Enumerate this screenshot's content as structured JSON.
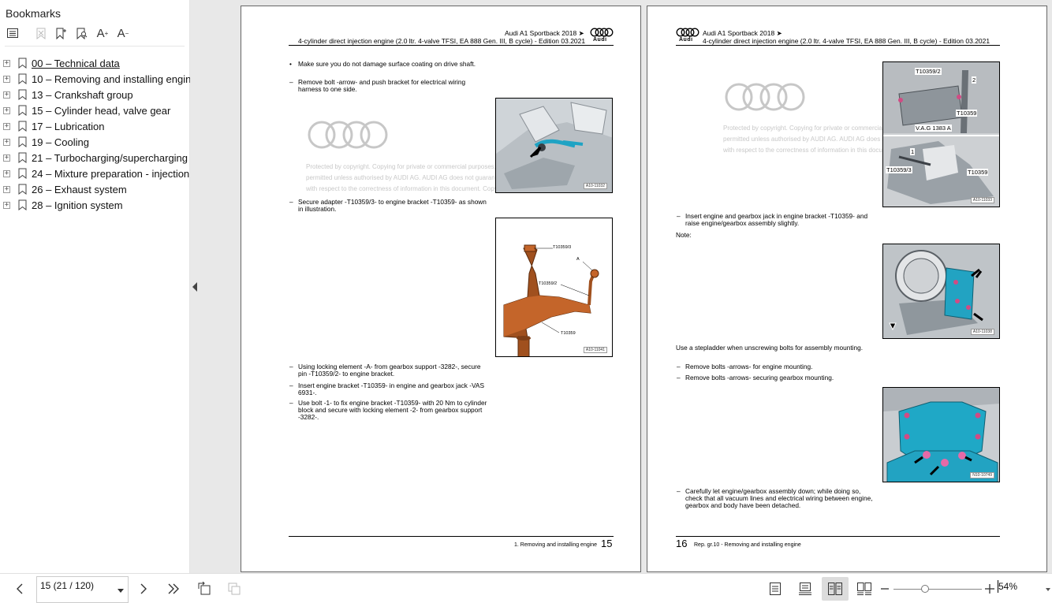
{
  "sidebar": {
    "title": "Bookmarks",
    "toolbar_icons": [
      "bookmark-options-icon",
      "delete-bookmark-icon",
      "add-bookmark-icon",
      "find-bookmark-icon",
      "increase-text-size-icon",
      "decrease-text-size-icon"
    ],
    "items": [
      {
        "label": "00 – Technical data",
        "active": true
      },
      {
        "label": "10 – Removing and installing engine"
      },
      {
        "label": "13 – Crankshaft group"
      },
      {
        "label": "15 – Cylinder head, valve gear"
      },
      {
        "label": "17 – Lubrication"
      },
      {
        "label": "19 – Cooling"
      },
      {
        "label": "21 – Turbocharging/supercharging"
      },
      {
        "label": "24 – Mixture preparation - injection"
      },
      {
        "label": "26 – Exhaust system"
      },
      {
        "label": "28 – Ignition system"
      }
    ]
  },
  "document": {
    "header_model": "Audi A1 Sportback 2018 ➤",
    "header_engine": "4-cylinder direct injection engine (2.0 ltr. 4-valve TFSI, EA 888 Gen. III, B cycle) - Edition 03.2021",
    "audi_word": "Audi",
    "watermark": {
      "line1": "Protected by copyright. Copying for private or commercial purposes, in part or in whole, is not",
      "line2": "permitted unless authorised by AUDI AG. AUDI AG does not guarantee or accept any liability",
      "line3": "with respect to the correctness of information in this document. Copyright by AUDI AG."
    },
    "left_page": {
      "steps": [
        "Make sure you do not damage surface coating on drive shaft.",
        "Remove bolt -arrow- and push bracket for electrical wiring harness to one side.",
        "Secure adapter -T10359/3- to engine bracket -T10359- as shown in illustration.",
        "Using locking element -A- from gearbox support -3282-, secure pin -T10359/2- to engine bracket.",
        "Insert engine bracket -T10359- in engine and gearbox jack -VAS 6931-.",
        "Use bolt -1- to fix engine bracket -T10359- with 20 Nm to cylinder block and secure with locking element -2- from gearbox support -3282-."
      ],
      "fig1_id": "A10-11032",
      "fig2_labels": {
        "t3": "T10359/3",
        "a": "A",
        "t2": "T10359/2",
        "t": "T10359"
      },
      "fig2_id": "A10-11041",
      "footer_label": "1. Removing and installing engine",
      "page_number": "15"
    },
    "right_page": {
      "steps": [
        "Insert engine and gearbox jack in engine bracket -T10359- and raise engine/gearbox assembly slightly.",
        "Remove bolts -arrows- for engine mounting.",
        "Remove bolts -arrows- securing gearbox mounting.",
        "Carefully let engine/gearbox assembly down; while doing so, check that all vacuum lines and electrical wiring between engine, gearbox and body have been detached."
      ],
      "note_label": "Note:",
      "note_text": "Use a stepladder when unscrewing bolts for assembly mounting.",
      "fig1_labels": {
        "t2": "T10359/2",
        "n2": "2",
        "t": "T10359",
        "vag": "V.A.G  1383 A",
        "n1": "1",
        "t3": "T10359/3",
        "t_b": "T10359"
      },
      "fig1_id": "A10-11033",
      "fig2_id": "A10-11038",
      "fig3_id": "N10-10749",
      "footer_label": "Rep. gr.10 - Removing and installing engine",
      "page_number": "16"
    }
  },
  "bottombar": {
    "page_field": "15 (21 / 120)",
    "zoom": "54%",
    "zoom_level": 0.4,
    "icons": [
      "previous-page-icon",
      "next-page-icon",
      "last-page-icon",
      "rotate-icon",
      "copy-icon",
      "single-page-icon",
      "continuous-icon",
      "two-page-icon",
      "two-page-continuous-icon",
      "zoom-out-icon",
      "zoom-in-icon"
    ]
  }
}
